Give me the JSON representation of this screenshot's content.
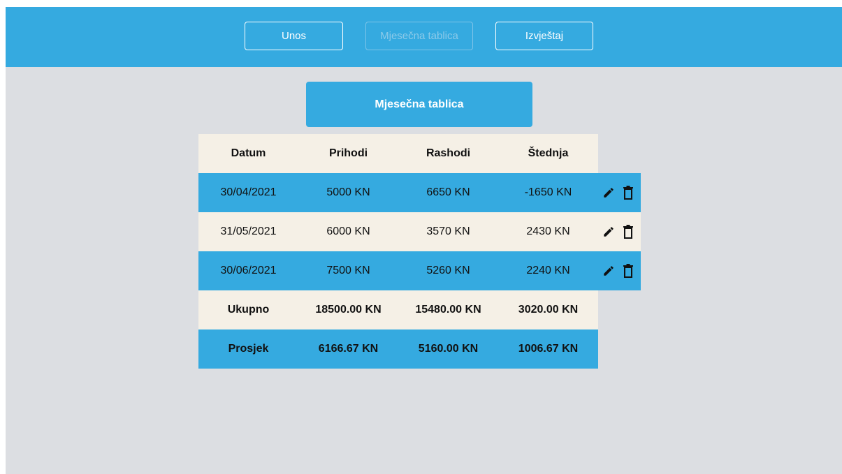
{
  "nav": {
    "items": [
      {
        "label": "Unos"
      },
      {
        "label": "Mjesečna tablica"
      },
      {
        "label": "Izvještaj"
      }
    ]
  },
  "page_title": "Mjesečna tablica",
  "table": {
    "headers": [
      "Datum",
      "Prihodi",
      "Rashodi",
      "Štednja"
    ],
    "rows": [
      {
        "datum": "30/04/2021",
        "prihodi": "5000 KN",
        "rashodi": "6650 KN",
        "stednja": "-1650 KN"
      },
      {
        "datum": "31/05/2021",
        "prihodi": "6000 KN",
        "rashodi": "3570 KN",
        "stednja": "2430 KN"
      },
      {
        "datum": "30/06/2021",
        "prihodi": "7500 KN",
        "rashodi": "5260 KN",
        "stednja": "2240 KN"
      }
    ],
    "total": {
      "label": "Ukupno",
      "prihodi": "18500.00 KN",
      "rashodi": "15480.00 KN",
      "stednja": "3020.00 KN"
    },
    "average": {
      "label": "Prosjek",
      "prihodi": "6166.67 KN",
      "rashodi": "5160.00 KN",
      "stednja": "1006.67 KN"
    }
  },
  "icons": {
    "edit": "pencil-icon",
    "delete": "trash-icon"
  },
  "colors": {
    "accent": "#35aae0",
    "cream": "#f5f0e6",
    "background": "#dcdee2"
  }
}
